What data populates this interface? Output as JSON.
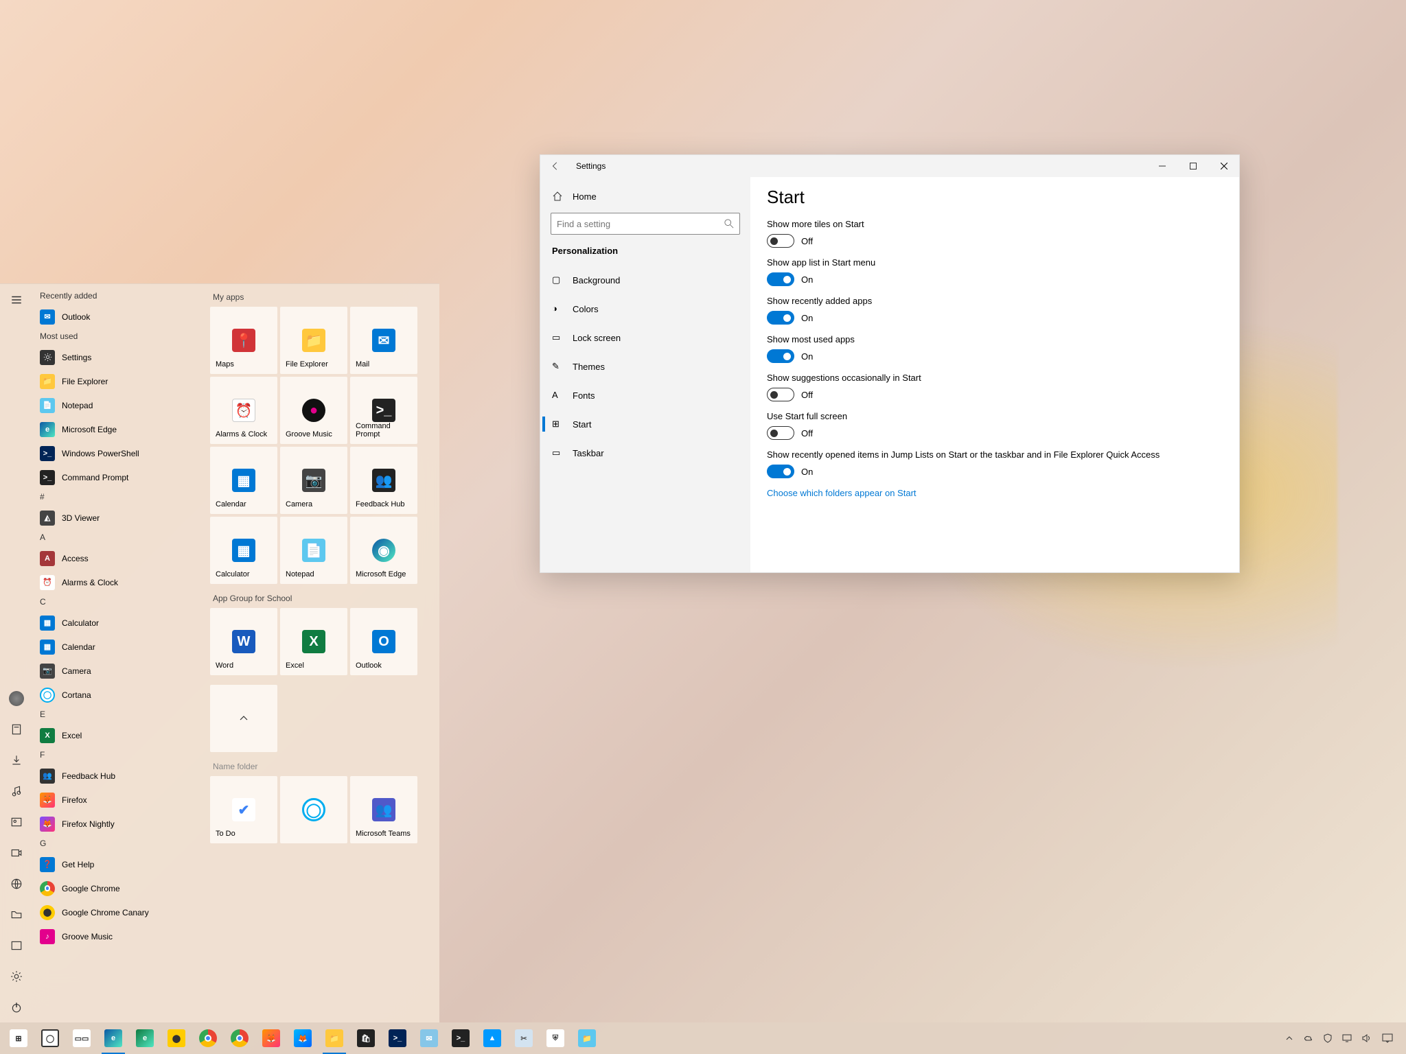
{
  "start_menu": {
    "recently_added_header": "Recently added",
    "recently_added": [
      {
        "label": "Outlook",
        "bg": "#0078d4",
        "fg": "#fff",
        "ic": "✉"
      }
    ],
    "most_used_header": "Most used",
    "most_used": [
      {
        "label": "Settings",
        "ic": "gear"
      },
      {
        "label": "File Explorer",
        "bg": "#ffc83d",
        "fg": "#333",
        "ic": "📁"
      },
      {
        "label": "Notepad",
        "bg": "#5dc8ef",
        "fg": "#fff",
        "ic": "📄"
      },
      {
        "label": "Microsoft Edge",
        "bg": "linear-gradient(135deg,#0c59a4,#50e6c2)",
        "fg": "#fff",
        "ic": "e"
      },
      {
        "label": "Windows PowerShell",
        "bg": "#012456",
        "fg": "#fff",
        "ic": ">_"
      },
      {
        "label": "Command Prompt",
        "bg": "#222",
        "fg": "#fff",
        "ic": ">_"
      }
    ],
    "alpha_hash": "#",
    "hash_apps": [
      {
        "label": "3D Viewer",
        "bg": "#444",
        "fg": "#fff",
        "ic": "◭"
      }
    ],
    "alpha_sections": [
      {
        "h": "A",
        "apps": [
          {
            "label": "Access",
            "bg": "#a4373a",
            "fg": "#fff",
            "ic": "A"
          },
          {
            "label": "Alarms & Clock",
            "bg": "#fff",
            "fg": "#333",
            "ic": "⏰"
          }
        ]
      },
      {
        "h": "C",
        "apps": [
          {
            "label": "Calculator",
            "bg": "#0078d4",
            "fg": "#fff",
            "ic": "▦"
          },
          {
            "label": "Calendar",
            "bg": "#0078d4",
            "fg": "#fff",
            "ic": "▦"
          },
          {
            "label": "Camera",
            "bg": "#444",
            "fg": "#fff",
            "ic": "📷"
          },
          {
            "label": "Cortana",
            "bg": "#fff",
            "fg": "#00adef",
            "ic": "◯",
            "border": "2px solid #00adef"
          }
        ]
      },
      {
        "h": "E",
        "apps": [
          {
            "label": "Excel",
            "bg": "#107c41",
            "fg": "#fff",
            "ic": "X"
          }
        ]
      },
      {
        "h": "F",
        "apps": [
          {
            "label": "Feedback Hub",
            "bg": "#333",
            "fg": "#fff",
            "ic": "👥"
          },
          {
            "label": "Firefox",
            "bg": "linear-gradient(135deg,#ff9500,#ff3377)",
            "fg": "#fff",
            "ic": "🦊"
          },
          {
            "label": "Firefox Nightly",
            "bg": "linear-gradient(135deg,#7c4dff,#ff3377)",
            "fg": "#fff",
            "ic": "🦊"
          }
        ]
      },
      {
        "h": "G",
        "apps": [
          {
            "label": "Get Help",
            "bg": "#0078d4",
            "fg": "#fff",
            "ic": "❓"
          },
          {
            "label": "Google Chrome",
            "bg": "#fff",
            "fg": "#333",
            "ic": "⬤",
            "chrome": true
          },
          {
            "label": "Google Chrome Canary",
            "bg": "#ffcc00",
            "fg": "#333",
            "ic": "⬤"
          },
          {
            "label": "Groove Music",
            "bg": "#e3008c",
            "fg": "#fff",
            "ic": "♪"
          }
        ]
      }
    ],
    "tiles_header": "My apps",
    "tiles_g1": [
      {
        "label": "Maps",
        "bg": "#d13438",
        "fg": "#fff",
        "ic": "📍"
      },
      {
        "label": "File Explorer",
        "bg": "#ffc83d",
        "fg": "#333",
        "ic": "📁"
      },
      {
        "label": "Mail",
        "bg": "#0078d4",
        "fg": "#fff",
        "ic": "✉"
      },
      {
        "label": "Alarms & Clock",
        "bg": "#fff",
        "fg": "#333",
        "ic": "⏰",
        "border": "1px solid #ccc"
      },
      {
        "label": "Groove Music",
        "bg": "#111",
        "fg": "#e3008c",
        "ic": "●"
      },
      {
        "label": "Command Prompt",
        "bg": "#222",
        "fg": "#fff",
        "ic": ">_"
      },
      {
        "label": "Calendar",
        "bg": "#0078d4",
        "fg": "#fff",
        "ic": "▦"
      },
      {
        "label": "Camera",
        "bg": "#444",
        "fg": "#fff",
        "ic": "📷"
      },
      {
        "label": "Feedback Hub",
        "bg": "#222",
        "fg": "#fff",
        "ic": "👥"
      },
      {
        "label": "Calculator",
        "bg": "#0078d4",
        "fg": "#fff",
        "ic": "▦"
      },
      {
        "label": "Notepad",
        "bg": "#5dc8ef",
        "fg": "#fff",
        "ic": "📄"
      },
      {
        "label": "Microsoft Edge",
        "bg": "linear-gradient(135deg,#0c59a4,#50e6c2)",
        "fg": "#fff",
        "ic": "◉"
      }
    ],
    "tiles_header2": "App Group for School",
    "tiles_g2": [
      {
        "label": "Word",
        "bg": "#185abd",
        "fg": "#fff",
        "ic": "W"
      },
      {
        "label": "Excel",
        "bg": "#107c41",
        "fg": "#fff",
        "ic": "X"
      },
      {
        "label": "Outlook",
        "bg": "#0078d4",
        "fg": "#fff",
        "ic": "O"
      }
    ],
    "tiles_header3": "Name folder",
    "tiles_g3": [
      {
        "label": "To Do",
        "bg": "#fff",
        "fg": "#3b82f6",
        "ic": "✔"
      },
      {
        "label": "",
        "bg": "#fff",
        "fg": "#00adef",
        "ic": "◯",
        "border": "3px solid #00adef"
      },
      {
        "label": "Microsoft Teams",
        "bg": "#5059c9",
        "fg": "#fff",
        "ic": "👥"
      }
    ]
  },
  "settings": {
    "title": "Settings",
    "home": "Home",
    "search_placeholder": "Find a setting",
    "section": "Personalization",
    "nav": [
      {
        "label": "Background",
        "ic": "▢"
      },
      {
        "label": "Colors",
        "ic": "◑"
      },
      {
        "label": "Lock screen",
        "ic": "▭"
      },
      {
        "label": "Themes",
        "ic": "✎"
      },
      {
        "label": "Fonts",
        "ic": "A"
      },
      {
        "label": "Start",
        "ic": "⊞",
        "active": true
      },
      {
        "label": "Taskbar",
        "ic": "▭"
      }
    ],
    "content_title": "Start",
    "opts": [
      {
        "label": "Show more tiles on Start",
        "on": false,
        "state": "Off"
      },
      {
        "label": "Show app list in Start menu",
        "on": true,
        "state": "On"
      },
      {
        "label": "Show recently added apps",
        "on": true,
        "state": "On"
      },
      {
        "label": "Show most used apps",
        "on": true,
        "state": "On"
      },
      {
        "label": "Show suggestions occasionally in Start",
        "on": false,
        "state": "Off"
      },
      {
        "label": "Use Start full screen",
        "on": false,
        "state": "Off"
      },
      {
        "label": "Show recently opened items in Jump Lists on Start or the taskbar and in File Explorer Quick Access",
        "on": true,
        "state": "On"
      }
    ],
    "link": "Choose which folders appear on Start"
  },
  "taskbar": {
    "apps": [
      {
        "name": "start",
        "bg": "#fff",
        "ic": "⊞",
        "fg": "#222"
      },
      {
        "name": "search",
        "bg": "#fff",
        "ic": "◯",
        "fg": "#333",
        "border": "2px solid #333"
      },
      {
        "name": "task-view",
        "bg": "#fff",
        "ic": "▭▭",
        "fg": "#333"
      },
      {
        "name": "edge",
        "bg": "linear-gradient(135deg,#0c59a4,#50e6c2)",
        "ic": "e",
        "fg": "#fff",
        "open": true
      },
      {
        "name": "edge-dev",
        "bg": "linear-gradient(135deg,#107c41,#50e6c2)",
        "ic": "e",
        "fg": "#fff"
      },
      {
        "name": "chrome-canary",
        "bg": "#ffcc00",
        "ic": "⬤",
        "fg": "#333"
      },
      {
        "name": "chrome",
        "bg": "#fff",
        "ic": "⬤",
        "fg": "#333",
        "chrome": true
      },
      {
        "name": "chrome2",
        "bg": "#fff",
        "ic": "⬤",
        "fg": "#333",
        "chrome": true
      },
      {
        "name": "firefox",
        "bg": "linear-gradient(135deg,#ff9500,#ff3377)",
        "ic": "🦊",
        "fg": "#fff"
      },
      {
        "name": "firefox-dev",
        "bg": "linear-gradient(135deg,#00b7ff,#0066ff)",
        "ic": "🦊",
        "fg": "#fff"
      },
      {
        "name": "file-explorer",
        "bg": "#ffc83d",
        "ic": "📁",
        "fg": "#333",
        "open": true
      },
      {
        "name": "store",
        "bg": "#222",
        "ic": "🛍",
        "fg": "#fff"
      },
      {
        "name": "powershell",
        "bg": "#012456",
        "ic": ">_",
        "fg": "#fff"
      },
      {
        "name": "mail",
        "bg": "#86c6e8",
        "ic": "✉",
        "fg": "#fff"
      },
      {
        "name": "cmd",
        "bg": "#222",
        "ic": ">_",
        "fg": "#fff"
      },
      {
        "name": "photos",
        "bg": "#0099ff",
        "ic": "▲",
        "fg": "#fff"
      },
      {
        "name": "snip",
        "bg": "#d3e3f0",
        "ic": "✂",
        "fg": "#555"
      },
      {
        "name": "security",
        "bg": "#fff",
        "ic": "⛨",
        "fg": "#333"
      },
      {
        "name": "folder",
        "bg": "#5dc8ef",
        "ic": "📁",
        "fg": "#fff"
      }
    ]
  }
}
